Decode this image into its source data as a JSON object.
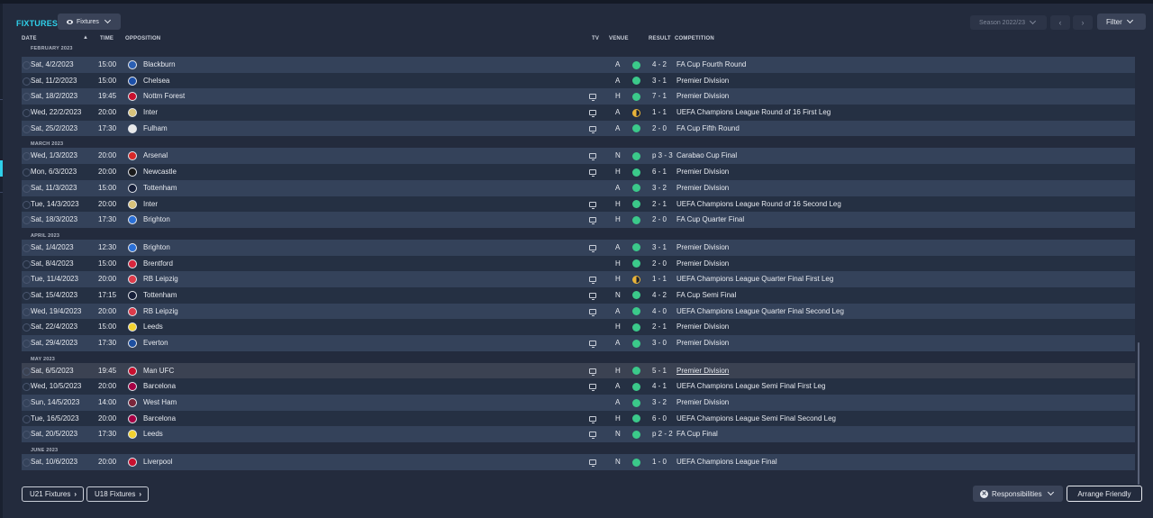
{
  "header": {
    "title": "FIXTURES",
    "view_dropdown": "Fixtures",
    "season": "Season 2022/23",
    "prev": "‹",
    "next": "›",
    "filter": "Filter"
  },
  "columns": {
    "date": "DATE",
    "time": "TIME",
    "opposition": "OPPOSITION",
    "tv": "TV",
    "venue": "VENUE",
    "result": "RESULT",
    "competition": "COMPETITION"
  },
  "colors": {
    "accent": "#2fd0ea",
    "win": "#3bc98a",
    "draw": "#e8b339"
  },
  "months": [
    {
      "label": "FEBRUARY 2023",
      "matches": [
        {
          "date": "Sat, 4/2/2023",
          "time": "15:00",
          "opp": "Blackburn",
          "crest": "#2b5fb3",
          "tv": false,
          "venue": "A",
          "outcome": "win",
          "result": "4 - 2",
          "comp": "FA Cup Fourth Round"
        },
        {
          "date": "Sat, 11/2/2023",
          "time": "15:00",
          "opp": "Chelsea",
          "crest": "#1b4fa8",
          "tv": false,
          "venue": "A",
          "outcome": "win",
          "result": "3 - 1",
          "comp": "Premier Division"
        },
        {
          "date": "Sat, 18/2/2023",
          "time": "19:45",
          "opp": "Nottm Forest",
          "crest": "#c8102e",
          "tv": true,
          "venue": "H",
          "outcome": "win",
          "result": "7 - 1",
          "comp": "Premier Division"
        },
        {
          "date": "Wed, 22/2/2023",
          "time": "20:00",
          "opp": "Inter",
          "crest": "#d8c27a",
          "tv": true,
          "venue": "A",
          "outcome": "draw",
          "result": "1 - 1",
          "comp": "UEFA Champions League Round of 16  First Leg"
        },
        {
          "date": "Sat, 25/2/2023",
          "time": "17:30",
          "opp": "Fulham",
          "crest": "#e8e8e8",
          "tv": true,
          "venue": "A",
          "outcome": "win",
          "result": "2 - 0",
          "comp": "FA Cup Fifth Round"
        }
      ]
    },
    {
      "label": "MARCH 2023",
      "matches": [
        {
          "date": "Wed, 1/3/2023",
          "time": "20:00",
          "opp": "Arsenal",
          "crest": "#d62828",
          "tv": true,
          "venue": "N",
          "outcome": "win",
          "result": "p 3 - 3",
          "comp": "Carabao Cup Final"
        },
        {
          "date": "Mon, 6/3/2023",
          "time": "20:00",
          "opp": "Newcastle",
          "crest": "#1a1a1a",
          "tv": true,
          "venue": "H",
          "outcome": "win",
          "result": "6 - 1",
          "comp": "Premier Division"
        },
        {
          "date": "Sat, 11/3/2023",
          "time": "15:00",
          "opp": "Tottenham",
          "crest": "#17203a",
          "tv": false,
          "venue": "A",
          "outcome": "win",
          "result": "3 - 2",
          "comp": "Premier Division"
        },
        {
          "date": "Tue, 14/3/2023",
          "time": "20:00",
          "opp": "Inter",
          "crest": "#d8c27a",
          "tv": true,
          "venue": "H",
          "outcome": "win",
          "result": "2 - 1",
          "comp": "UEFA Champions League Round of 16  Second Leg"
        },
        {
          "date": "Sat, 18/3/2023",
          "time": "17:30",
          "opp": "Brighton",
          "crest": "#2a6fd6",
          "tv": true,
          "venue": "H",
          "outcome": "win",
          "result": "2 - 0",
          "comp": "FA Cup Quarter Final"
        }
      ]
    },
    {
      "label": "APRIL 2023",
      "matches": [
        {
          "date": "Sat, 1/4/2023",
          "time": "12:30",
          "opp": "Brighton",
          "crest": "#2a6fd6",
          "tv": true,
          "venue": "A",
          "outcome": "win",
          "result": "3 - 1",
          "comp": "Premier Division"
        },
        {
          "date": "Sat, 8/4/2023",
          "time": "15:00",
          "opp": "Brentford",
          "crest": "#d7263d",
          "tv": false,
          "venue": "H",
          "outcome": "win",
          "result": "2 - 0",
          "comp": "Premier Division"
        },
        {
          "date": "Tue, 11/4/2023",
          "time": "20:00",
          "opp": "RB Leipzig",
          "crest": "#dd3b4a",
          "tv": true,
          "venue": "H",
          "outcome": "draw",
          "result": "1 - 1",
          "comp": "UEFA Champions League Quarter Final First Leg"
        },
        {
          "date": "Sat, 15/4/2023",
          "time": "17:15",
          "opp": "Tottenham",
          "crest": "#17203a",
          "tv": true,
          "venue": "N",
          "outcome": "win",
          "result": "4 - 2",
          "comp": "FA Cup Semi Final"
        },
        {
          "date": "Wed, 19/4/2023",
          "time": "20:00",
          "opp": "RB Leipzig",
          "crest": "#dd3b4a",
          "tv": true,
          "venue": "A",
          "outcome": "win",
          "result": "4 - 0",
          "comp": "UEFA Champions League Quarter Final Second Leg"
        },
        {
          "date": "Sat, 22/4/2023",
          "time": "15:00",
          "opp": "Leeds",
          "crest": "#f2d230",
          "tv": false,
          "venue": "H",
          "outcome": "win",
          "result": "2 - 1",
          "comp": "Premier Division"
        },
        {
          "date": "Sat, 29/4/2023",
          "time": "17:30",
          "opp": "Everton",
          "crest": "#1d4fa0",
          "tv": true,
          "venue": "A",
          "outcome": "win",
          "result": "3 - 0",
          "comp": "Premier Division"
        }
      ]
    },
    {
      "label": "MAY 2023",
      "matches": [
        {
          "date": "Sat, 6/5/2023",
          "time": "19:45",
          "opp": "Man UFC",
          "crest": "#c8102e",
          "tv": true,
          "venue": "H",
          "outcome": "win",
          "result": "5 - 1",
          "comp": "Premier Division",
          "underline": true,
          "highlight": true
        },
        {
          "date": "Wed, 10/5/2023",
          "time": "20:00",
          "opp": "Barcelona",
          "crest": "#a50044",
          "tv": true,
          "venue": "A",
          "outcome": "win",
          "result": "4 - 1",
          "comp": "UEFA Champions League Semi Final First Leg"
        },
        {
          "date": "Sun, 14/5/2023",
          "time": "14:00",
          "opp": "West Ham",
          "crest": "#7a263a",
          "tv": false,
          "venue": "A",
          "outcome": "win",
          "result": "3 - 2",
          "comp": "Premier Division"
        },
        {
          "date": "Tue, 16/5/2023",
          "time": "20:00",
          "opp": "Barcelona",
          "crest": "#a50044",
          "tv": true,
          "venue": "H",
          "outcome": "win",
          "result": "6 - 0",
          "comp": "UEFA Champions League Semi Final Second Leg"
        },
        {
          "date": "Sat, 20/5/2023",
          "time": "17:30",
          "opp": "Leeds",
          "crest": "#f2d230",
          "tv": true,
          "venue": "N",
          "outcome": "win",
          "result": "p 2 - 2",
          "comp": "FA Cup Final"
        }
      ]
    },
    {
      "label": "JUNE 2023",
      "matches": [
        {
          "date": "Sat, 10/6/2023",
          "time": "20:00",
          "opp": "Liverpool",
          "crest": "#c8102e",
          "tv": true,
          "venue": "N",
          "outcome": "win",
          "result": "1 - 0",
          "comp": "UEFA Champions League Final"
        }
      ]
    }
  ],
  "footer": {
    "u21": "U21 Fixtures",
    "u18": "U18 Fixtures",
    "responsibilities": "Responsibilities",
    "arrange": "Arrange Friendly"
  }
}
